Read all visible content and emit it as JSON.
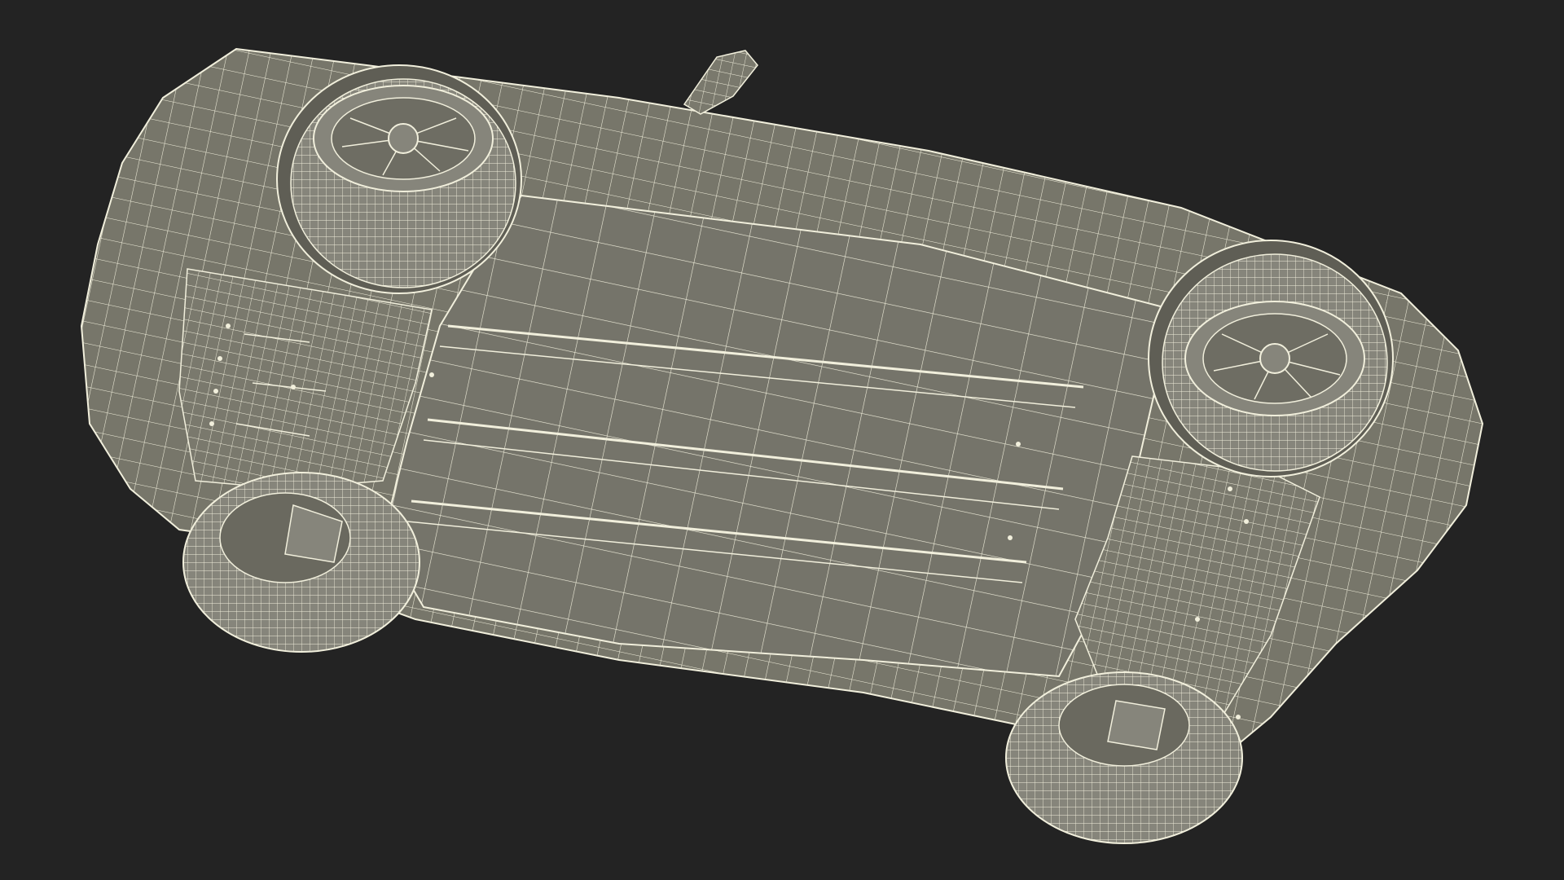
{
  "scene": {
    "background_color": "#232323",
    "mesh_fill_color": "#77766a",
    "mesh_fill_dark": "#5e5d53",
    "wire_color": "#f1efdc",
    "tire_color": "#85847a",
    "subject": "car-underside-wireframe"
  }
}
